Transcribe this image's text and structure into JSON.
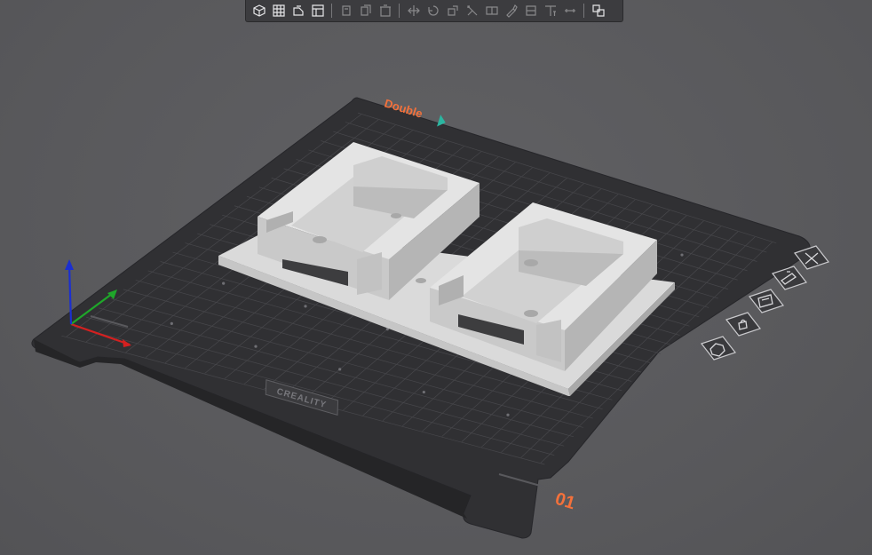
{
  "app": {
    "name": "3D slicer viewport"
  },
  "toolbar": {
    "groups": [
      [
        "add-object-icon",
        "arrange-grid-icon",
        "orient-icon",
        "layout-icon"
      ],
      [
        "copy-icon",
        "paste-icon",
        "delete-icon"
      ],
      [
        "move-icon",
        "rotate-icon",
        "scale-icon",
        "cut-icon",
        "split-icon",
        "support-paint-icon",
        "seam-paint-icon",
        "text-tool-icon",
        "measure-icon"
      ],
      [
        "assembly-icon"
      ]
    ]
  },
  "bed": {
    "brand_text": "Double",
    "logo_text": "CREALITY",
    "plate_number": "01",
    "accent_color": "#f4713b",
    "teal_color": "#2bb5a0",
    "surface_color": "#2f2f31"
  },
  "plate_tools": [
    {
      "name": "close-plate-icon",
      "label": ""
    },
    {
      "name": "auto-orient-icon",
      "label": ""
    },
    {
      "name": "arrange-icon",
      "label": ""
    },
    {
      "name": "lock-icon",
      "label": ""
    },
    {
      "name": "plate-settings-icon",
      "label": ""
    }
  ],
  "axes": {
    "x_color": "#d42020",
    "y_color": "#1fa72a",
    "z_color": "#1b2fd0"
  }
}
